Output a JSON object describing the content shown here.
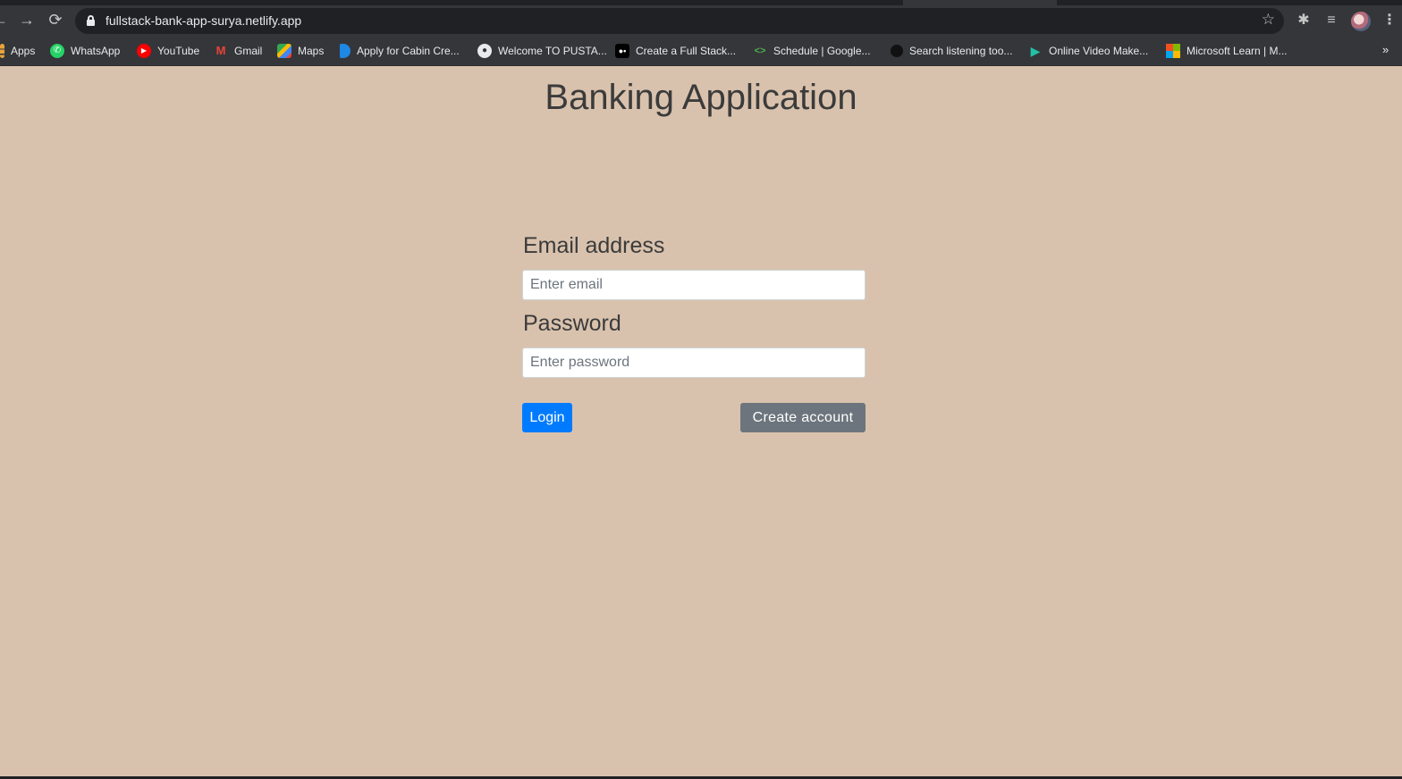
{
  "browser": {
    "url": "fullstack-bank-app-surya.netlify.app",
    "bookmarks": [
      {
        "label": "Apps",
        "icon": "apps-grid-icon"
      },
      {
        "label": "WhatsApp",
        "icon": "whatsapp-icon"
      },
      {
        "label": "YouTube",
        "icon": "youtube-icon"
      },
      {
        "label": "Gmail",
        "icon": "gmail-icon"
      },
      {
        "label": "Maps",
        "icon": "maps-icon"
      },
      {
        "label": "Apply for Cabin Cre...",
        "icon": "page-icon"
      },
      {
        "label": "Welcome TO PUSTA...",
        "icon": "globe-icon"
      },
      {
        "label": "Create a Full Stack...",
        "icon": "medium-icon"
      },
      {
        "label": "Schedule | Google...",
        "icon": "google-dev-icon"
      },
      {
        "label": "Search listening too...",
        "icon": "answer-icon"
      },
      {
        "label": "Online Video Make...",
        "icon": "play-icon"
      },
      {
        "label": "Microsoft Learn | M...",
        "icon": "microsoft-icon"
      }
    ]
  },
  "page": {
    "title": "Banking Application",
    "form": {
      "email_label": "Email address",
      "email_placeholder": "Enter email",
      "email_value": "",
      "password_label": "Password",
      "password_placeholder": "Enter password",
      "password_value": "",
      "login_label": "Login",
      "create_label": "Create account"
    }
  },
  "colors": {
    "page_background": "#d9c2ad",
    "primary_button": "#007bff",
    "secondary_button": "#6c757d"
  }
}
